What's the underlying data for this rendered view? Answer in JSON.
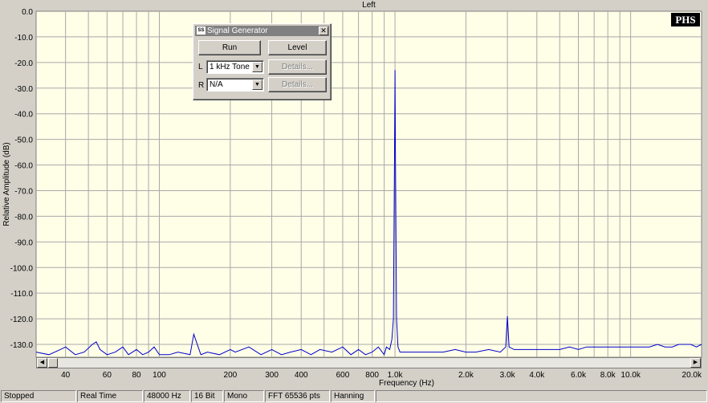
{
  "chart_data": {
    "type": "line",
    "title": "Left",
    "xlabel": "Frequency (Hz)",
    "ylabel": "Relative Amplitude (dB)",
    "x_scale": "log",
    "xlim": [
      30,
      20000
    ],
    "ylim": [
      -135,
      0
    ],
    "grid": true,
    "colors": {
      "plot_bg": "#ffffe8",
      "grid": "#a8a8a8",
      "line": "#0000cc"
    },
    "y_ticks": [
      0,
      -10,
      -20,
      -30,
      -40,
      -50,
      -60,
      -70,
      -80,
      -90,
      -100,
      -110,
      -120,
      -130
    ],
    "y_tick_labels": [
      "0.0",
      "-10.0",
      "-20.0",
      "-30.0",
      "-40.0",
      "-50.0",
      "-60.0",
      "-70.0",
      "-80.0",
      "-90.0",
      "-100.0",
      "-110.0",
      "-120.0",
      "-130.0"
    ],
    "x_ticks": [
      40,
      60,
      80,
      100,
      200,
      300,
      400,
      600,
      800,
      1000,
      2000,
      3000,
      4000,
      6000,
      8000,
      10000,
      20000
    ],
    "x_tick_labels": [
      "40",
      "60",
      "80",
      "100",
      "200",
      "300",
      "400",
      "600",
      "800",
      "1.0k",
      "2.0k",
      "3.0k",
      "4.0k",
      "6.0k",
      "8.0k",
      "10.0k",
      "20.0k"
    ],
    "series": [
      {
        "x": [
          30,
          34,
          38,
          40,
          44,
          48,
          52,
          54,
          56,
          60,
          65,
          70,
          74,
          80,
          85,
          90,
          95,
          100,
          110,
          120,
          135,
          140,
          150,
          160,
          180,
          200,
          210,
          240,
          270,
          300,
          330,
          360,
          400,
          440,
          480,
          540,
          600,
          650,
          700,
          750,
          800,
          850,
          900,
          920,
          950,
          970,
          985,
          995,
          1000,
          1005,
          1015,
          1030,
          1050,
          1100,
          1200,
          1400,
          1600,
          1800,
          2000,
          2200,
          2500,
          2800,
          2950,
          3000,
          3050,
          3200,
          3600,
          4000,
          4500,
          5000,
          5500,
          6000,
          6500,
          7000,
          7500,
          8000,
          8500,
          9000,
          10000,
          11000,
          12000,
          13000,
          14000,
          15000,
          16000,
          17000,
          18000,
          19000,
          20000
        ],
        "y": [
          -133,
          -134,
          -132,
          -131,
          -134,
          -133,
          -130,
          -129,
          -132,
          -134,
          -133,
          -131,
          -134,
          -132,
          -134,
          -133,
          -131,
          -134,
          -134,
          -133,
          -134,
          -126,
          -134,
          -133,
          -134,
          -132,
          -133,
          -131,
          -134,
          -132,
          -134,
          -133,
          -132,
          -134,
          -132,
          -133,
          -131,
          -134,
          -132,
          -134,
          -133,
          -131,
          -134,
          -131,
          -132,
          -128,
          -120,
          -60,
          -23,
          -60,
          -120,
          -131,
          -133,
          -133,
          -133,
          -133,
          -133,
          -132,
          -133,
          -133,
          -132,
          -133,
          -131,
          -119,
          -131,
          -132,
          -132,
          -132,
          -132,
          -132,
          -131,
          -132,
          -131,
          -131,
          -131,
          -131,
          -131,
          -131,
          -131,
          -131,
          -131,
          -130,
          -131,
          -131,
          -130,
          -130,
          -130,
          -131,
          -130
        ]
      }
    ]
  },
  "logo": {
    "text": "PHS"
  },
  "signal_generator": {
    "title": "Signal Generator",
    "close_glyph": "✕",
    "run_label": "Run",
    "level_label": "Level",
    "left_label": "L",
    "right_label": "R",
    "left_value": "1 kHz Tone",
    "right_value": "N/A",
    "details_label": "Details..."
  },
  "scrollbar": {
    "left_arrow": "◀",
    "right_arrow": "▶"
  },
  "status": {
    "state": "Stopped",
    "mode": "Real Time",
    "sample_rate": "48000 Hz",
    "bit_depth": "16 Bit",
    "channels": "Mono",
    "fft": "FFT 65536 pts",
    "window": "Hanning"
  }
}
